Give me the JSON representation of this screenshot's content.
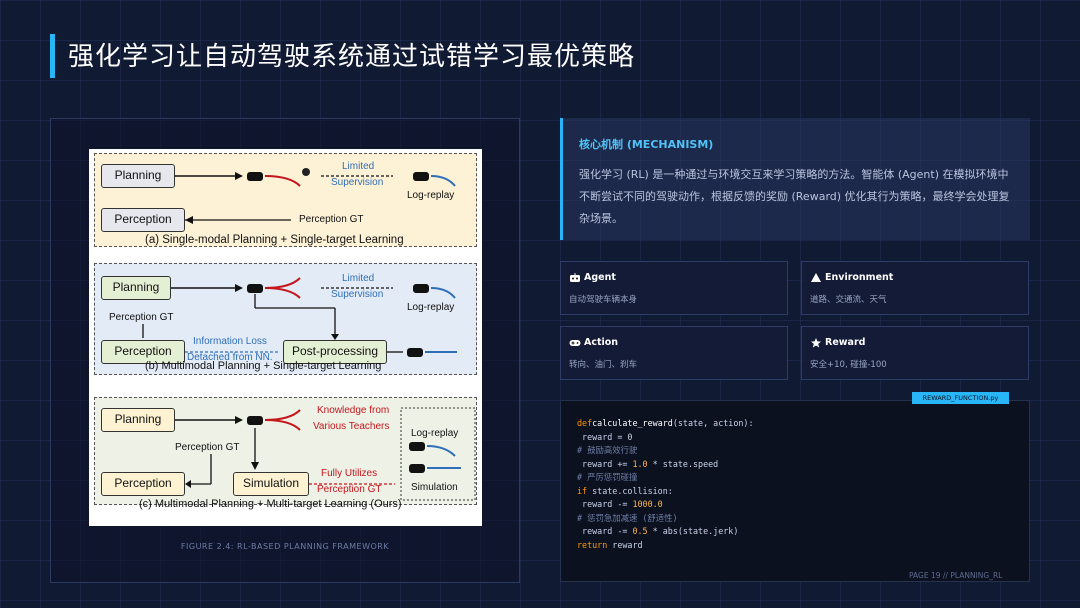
{
  "title": "强化学习让自动驾驶系统通过试错学习最优策略",
  "figure": {
    "caption": "FIGURE 2.4: RL-BASED PLANNING FRAMEWORK",
    "panel_a": {
      "planning": "Planning",
      "perception": "Perception",
      "limited": "Limited",
      "supervision": "Supervision",
      "log_replay": "Log-replay",
      "perception_gt": "Perception GT",
      "caption": "(a) Single-modal Planning + Single-target Learning"
    },
    "panel_b": {
      "planning": "Planning",
      "perception": "Perception",
      "post_processing": "Post-processing",
      "limited": "Limited",
      "supervision": "Supervision",
      "log_replay": "Log-replay",
      "perception_gt": "Perception GT",
      "info_loss": "Information Loss",
      "detached": "Detached from NN.",
      "caption": "(b) Multimodal Planning + Single-target Learning"
    },
    "panel_c": {
      "planning": "Planning",
      "perception": "Perception",
      "simulation": "Simulation",
      "knowledge_from": "Knowledge from",
      "various_teachers": "Various Teachers",
      "log_replay": "Log-replay",
      "simulation_label": "Simulation",
      "perception_gt": "Perception GT",
      "fully_utilizes": "Fully Utilizes",
      "perception_gt_red": "Perception GT",
      "caption": "(c) Multimodal Planning + Multi-target Learning (Ours)"
    }
  },
  "mechanism": {
    "heading": "核心机制 (MECHANISM)",
    "body": "强化学习 (RL) 是一种通过与环境交互来学习策略的方法。智能体 (Agent) 在模拟环境中不断尝试不同的驾驶动作，根据反馈的奖励 (Reward) 优化其行为策略，最终学会处理复杂场景。"
  },
  "cards": [
    {
      "icon": "robot-icon",
      "title": "Agent",
      "desc": "自动驾驶车辆本身"
    },
    {
      "icon": "globe-icon",
      "title": "Environment",
      "desc": "道路、交通流、天气"
    },
    {
      "icon": "gamepad-icon",
      "title": "Action",
      "desc": "转向、油门、刹车"
    },
    {
      "icon": "star-icon",
      "title": "Reward",
      "desc": "安全+10, 碰撞-100"
    }
  ],
  "code": {
    "tab": "REWARD_FUNCTION.py",
    "line1_kw": "def",
    "line1_fn": "calculate_reward",
    "line1_rest": "(state, action):",
    "line2": " reward = 0",
    "line3": "# 鼓励高效行驶",
    "line4_a": " reward += ",
    "line4_n": "1.0",
    "line4_b": " * state.speed",
    "line5": "# 严厉惩罚碰撞",
    "line6_kw": "if",
    "line6_rest": " state.collision:",
    "line7_a": " reward -= ",
    "line7_n": "1000.0",
    "line8": "# 惩罚急加减速 (舒适性)",
    "line9_a": " reward -= ",
    "line9_n": "0.5",
    "line9_b": " * abs(state.jerk)",
    "line10_kw": "return",
    "line10_rest": " reward"
  },
  "footer": "PAGE 19 // PLANNING_RL"
}
